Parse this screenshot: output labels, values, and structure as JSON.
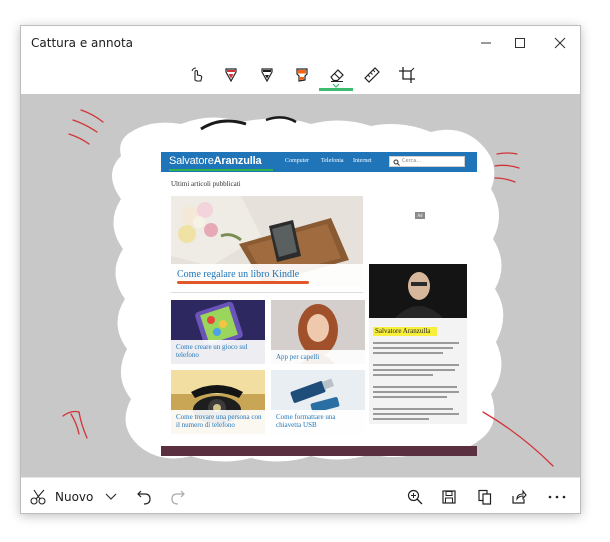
{
  "window": {
    "title": "Cattura e annota",
    "minimize_icon": "minimize-icon",
    "maximize_icon": "maximize-icon",
    "close_icon": "close-icon"
  },
  "toolbar": {
    "tools": [
      {
        "name": "touch-writing-icon"
      },
      {
        "name": "ballpoint-pen-icon",
        "color": "#d13438"
      },
      {
        "name": "pencil-icon",
        "color": "#1b1b1b"
      },
      {
        "name": "highlighter-icon",
        "color": "#f7630c"
      },
      {
        "name": "eraser-icon",
        "selected": true
      },
      {
        "name": "ruler-icon"
      },
      {
        "name": "crop-icon"
      }
    ],
    "selected_color": "#3cbc70"
  },
  "website": {
    "ad_label": "Ad",
    "logo_first": "Salvatore",
    "logo_second": "Aranzulla",
    "nav": [
      "Computer",
      "Telefonia",
      "Internet"
    ],
    "search_placeholder": "Cerca...",
    "section_title": "Ultimi articoli pubblicati",
    "featured_title": "Come regalare un libro Kindle",
    "articles": [
      {
        "title": "Come creare un gioco sul telefono"
      },
      {
        "title": "App per capelli"
      },
      {
        "title": "Come trovare una persona con il numero di telefono"
      },
      {
        "title": "Come formattare una chiavetta USB"
      }
    ],
    "author_name": "Salvatore Aranzulla",
    "brand_color": "#1f75b8"
  },
  "bottombar": {
    "new_label": "Nuovo",
    "icons": [
      "new-snip-icon",
      "chevron-down-icon",
      "undo-icon",
      "redo-icon",
      "zoom-in-icon",
      "save-icon",
      "copy-icon",
      "share-icon",
      "more-icon"
    ]
  }
}
